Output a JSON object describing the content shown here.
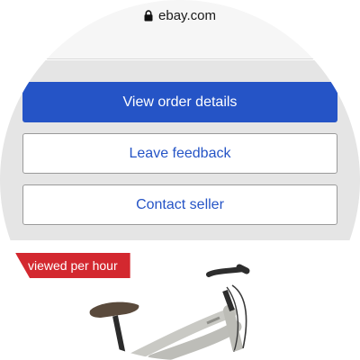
{
  "browser": {
    "url": "ebay.com",
    "lock_icon": "lock-icon"
  },
  "actions": {
    "view_order_label": "View order details",
    "leave_feedback_label": "Leave feedback",
    "contact_seller_label": "Contact seller"
  },
  "listing": {
    "badge_text": "viewed per hour"
  },
  "colors": {
    "primary": "#2554c6",
    "badge": "#d3282f",
    "panel": "#e5e5e5"
  }
}
